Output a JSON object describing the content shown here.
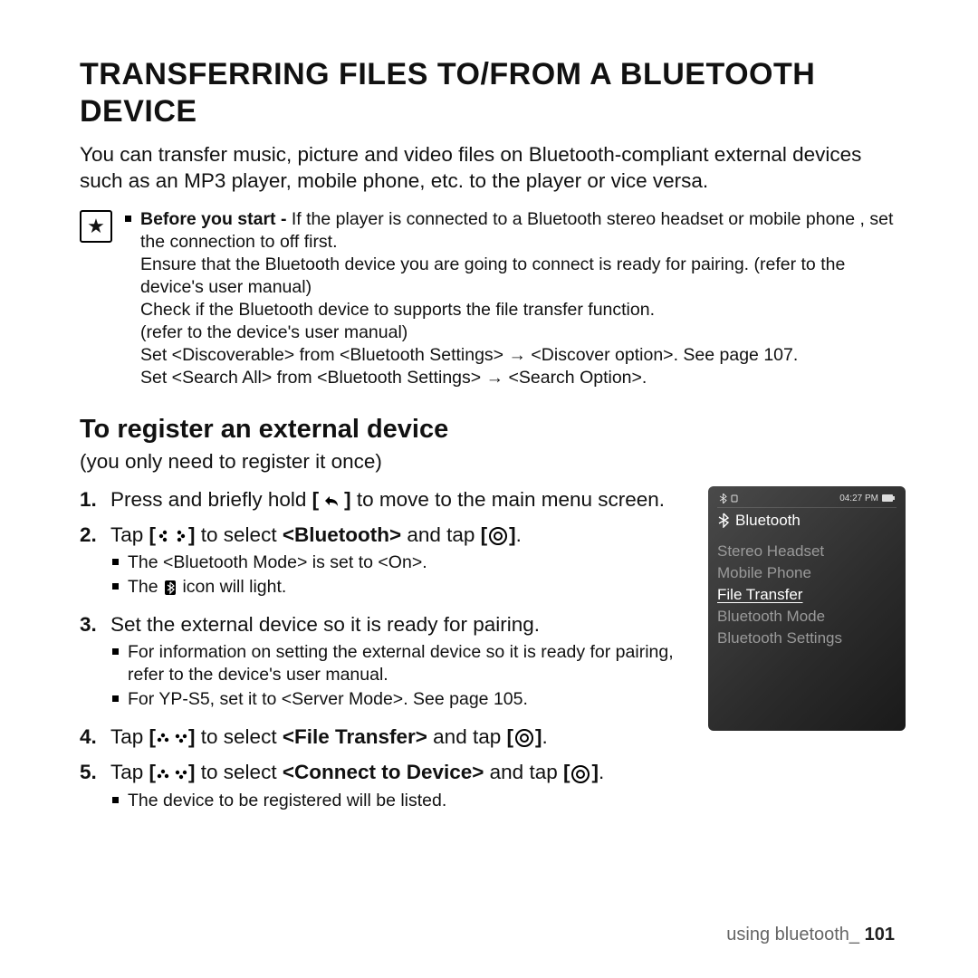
{
  "title": "TRANSFERRING FILES TO/FROM A BLUETOOTH DEVICE",
  "intro": "You can transfer music, picture and video files on Bluetooth-compliant external devices such as an MP3 player, mobile phone, etc. to the player or vice versa.",
  "note": {
    "before_label": "Before you start -",
    "before_text": " If the player is connected to a Bluetooth stereo headset or mobile phone , set the connection to off first.",
    "l2": "Ensure that the Bluetooth device you are going to connect is ready for pairing. (refer to the device's user manual)",
    "l3": "Check if the Bluetooth device to supports the file transfer function.",
    "l4": "(refer to the device's user manual)",
    "l5": "Set <Discoverable> from <Bluetooth Settings> → <Discover option>. See page 107.",
    "l6": "Set <Search All> from <Bluetooth Settings> → <Search Option>."
  },
  "subhead": "To register an external device",
  "subintro": "(you only need to register it once)",
  "steps": {
    "s1a": "Press and briefly hold ",
    "s1b": " to move to the main menu screen.",
    "s2a": "Tap ",
    "s2b": " to select ",
    "s2c": "<Bluetooth>",
    "s2d": " and tap ",
    "s2sub1": "The <Bluetooth Mode> is set to <On>.",
    "s2sub2a": "The ",
    "s2sub2b": " icon will light.",
    "s3": "Set the external device so it is ready for pairing.",
    "s3sub1": "For information on setting the external device so it is ready for pairing, refer to the device's user manual.",
    "s3sub2": "For YP-S5, set it to <Server Mode>. See page 105.",
    "s4a": "Tap ",
    "s4b": " to select ",
    "s4c": "<File Transfer>",
    "s4d": " and tap ",
    "s5a": "Tap ",
    "s5b": " to select ",
    "s5c": "<Connect to Device>",
    "s5d": " and tap ",
    "s5sub1": "The device to be registered will be listed."
  },
  "bracket_open": "[",
  "bracket_close": "]",
  "period": ".",
  "phone": {
    "time": "04:27 PM",
    "title": "Bluetooth",
    "menu": [
      "Stereo Headset",
      "Mobile Phone",
      "File Transfer",
      "Bluetooth Mode",
      "Bluetooth Settings"
    ],
    "selected_index": 2
  },
  "footer": {
    "section": "using bluetooth_",
    "page": "101"
  }
}
